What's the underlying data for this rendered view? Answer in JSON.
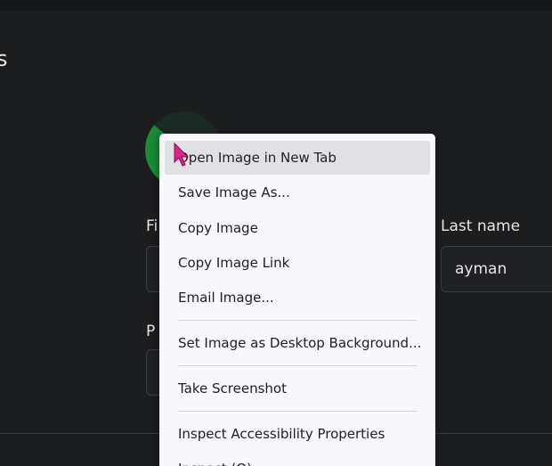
{
  "page": {
    "heading_fragment": "s"
  },
  "form": {
    "first_name_label_fragment": "Fi",
    "last_name_label": "Last name",
    "last_name_value": "ayman",
    "phone_label_fragment": "P"
  },
  "context_menu": {
    "items": [
      {
        "label": "Open Image in New Tab"
      },
      {
        "label": "Save Image As..."
      },
      {
        "label": "Copy Image"
      },
      {
        "label": "Copy Image Link"
      },
      {
        "label": "Email Image..."
      },
      {
        "label": "Set Image as Desktop Background..."
      },
      {
        "label": "Take Screenshot"
      },
      {
        "label": "Inspect Accessibility Properties"
      },
      {
        "label": "Inspect (Q)"
      }
    ]
  },
  "colors": {
    "background": "#1c1d1f",
    "menu_background": "#f8f8fa",
    "menu_hover": "#e1e1e5",
    "cursor": "#e0218a",
    "avatar_ring": "#1a8a3a"
  },
  "icons": {
    "cursor": "mouse-pointer-icon"
  }
}
